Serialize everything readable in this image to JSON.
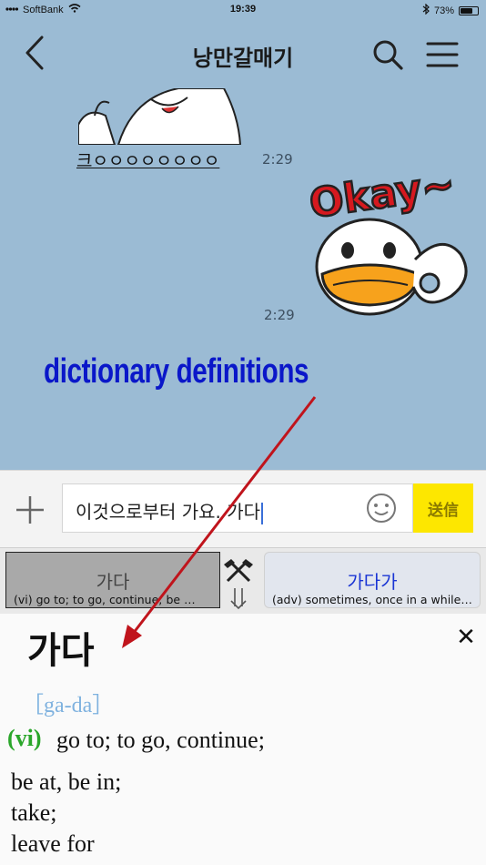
{
  "status": {
    "carrier": "SoftBank",
    "time": "19:39",
    "battery": "73%",
    "battery_level": 0.73
  },
  "header": {
    "title": "낭만갈매기"
  },
  "chat": {
    "message1_text": "크ㅇㅇㅇㅇㅇㅇㅇㅇ",
    "message1_time": "2:29",
    "sticker2_text": "Okay~",
    "message2_time": "2:29"
  },
  "annotation": {
    "caption": "dictionary definitions"
  },
  "input": {
    "value": "이것으로부터 가요. 가다",
    "send_label": "送信"
  },
  "dictionary": {
    "tabs": [
      {
        "word": "가다",
        "definition": "(vi) go to; to go, continue; be …"
      },
      {
        "word": "가다가",
        "definition": "(adv) sometimes, once in a while…"
      }
    ],
    "entry": {
      "headword": "가다",
      "pronunciation": "［ga-da］",
      "pos": "(vi)",
      "senses": [
        "go to; to go, continue;",
        "be at, be in;",
        "take;",
        "leave for"
      ]
    }
  },
  "colors": {
    "chat_bg": "#9bbbd4",
    "send_button": "#fde700",
    "caption": "#0a17c9",
    "arrow": "#c0141c",
    "pos": "#2aa62a",
    "link_word": "#1a35d4"
  }
}
